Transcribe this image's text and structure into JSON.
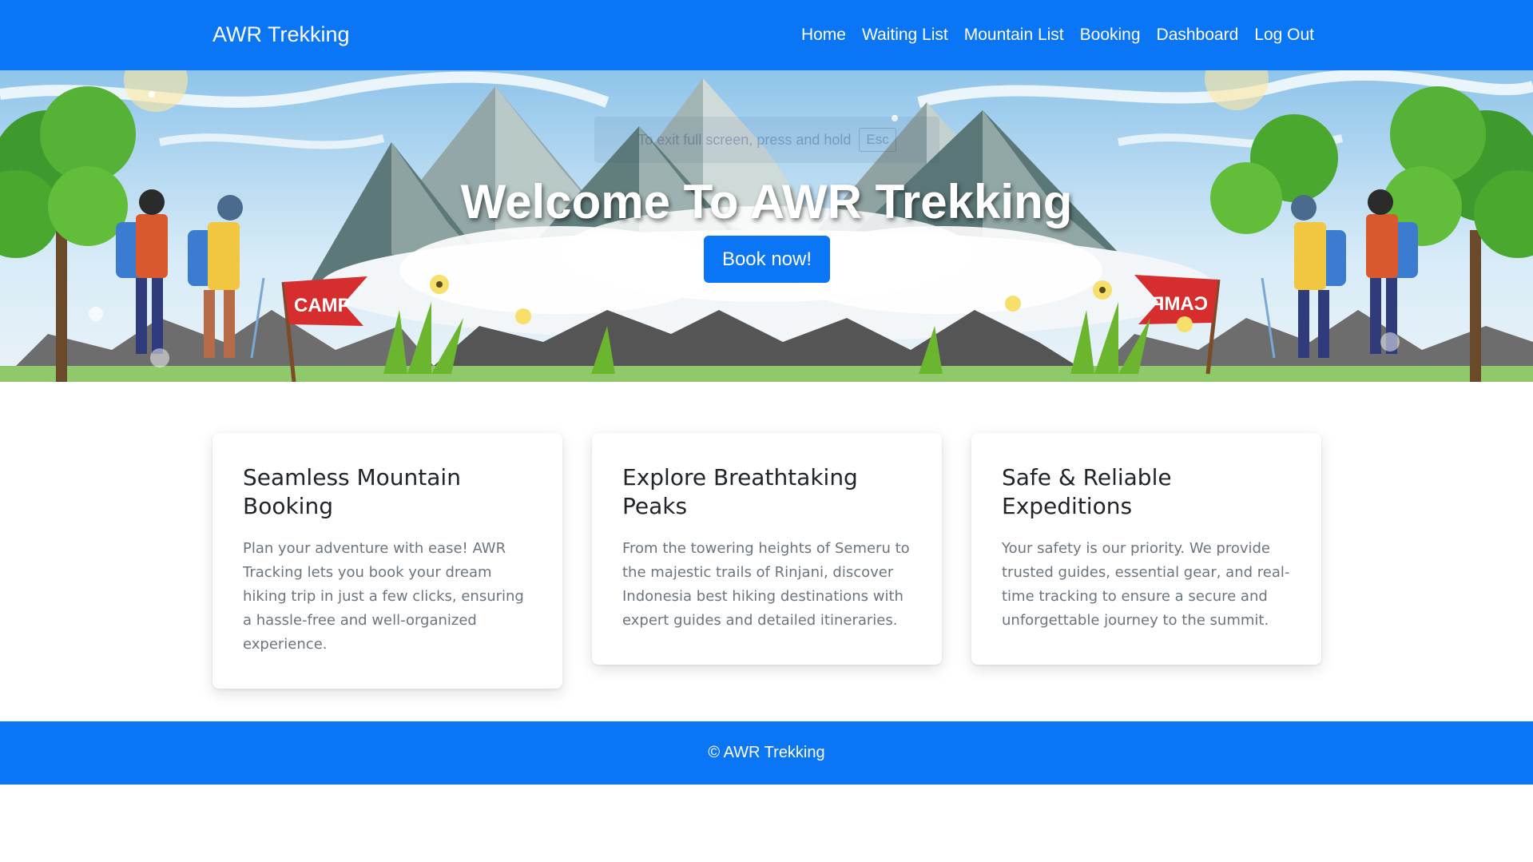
{
  "navbar": {
    "brand": "AWR Trekking",
    "links": [
      "Home",
      "Waiting List",
      "Mountain List",
      "Booking",
      "Dashboard",
      "Log Out"
    ]
  },
  "fullscreen_toast": {
    "text": "To exit full screen, press and hold",
    "key": "Esc"
  },
  "hero": {
    "title": "Welcome To AWR Trekking",
    "button": "Book now!",
    "flag_text": "CAMP"
  },
  "cards": [
    {
      "title": "Seamless Mountain Booking",
      "text": "Plan your adventure with ease! AWR Tracking lets you book your dream hiking trip in just a few clicks, ensuring a hassle-free and well-organized experience."
    },
    {
      "title": "Explore Breathtaking Peaks",
      "text": "From the towering heights of Semeru to the majestic trails of Rinjani, discover Indonesia best hiking destinations with expert guides and detailed itineraries."
    },
    {
      "title": "Safe & Reliable Expeditions",
      "text": "Your safety is our priority. We provide trusted guides, essential gear, and real-time tracking to ensure a secure and unforgettable journey to the summit."
    }
  ],
  "footer": {
    "text": "© AWR Trekking"
  },
  "colors": {
    "primary": "#0a75f5",
    "card_text": "#6c757d"
  }
}
